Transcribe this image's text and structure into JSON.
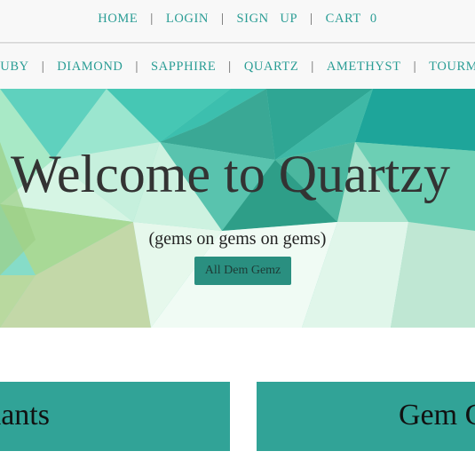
{
  "topnav": {
    "items": [
      "HOME",
      "LOGIN",
      "SIGN   UP",
      "CART"
    ],
    "cart_count": "0"
  },
  "gemnav": {
    "items": [
      "RUBY",
      "DIAMOND",
      "SAPPHIRE",
      "QUARTZ",
      "AMETHYST",
      "TOURMALINE"
    ]
  },
  "hero": {
    "title": "Welcome to Quartzy",
    "subtitle": "(gems on gems on gems)",
    "button_label": "All Dem Gemz"
  },
  "cards": [
    {
      "label": "Pendants"
    },
    {
      "label": "Gem Cards"
    }
  ],
  "colors": {
    "accent": "#2a9d95",
    "card": "#31a397",
    "button": "#2a8f80"
  }
}
